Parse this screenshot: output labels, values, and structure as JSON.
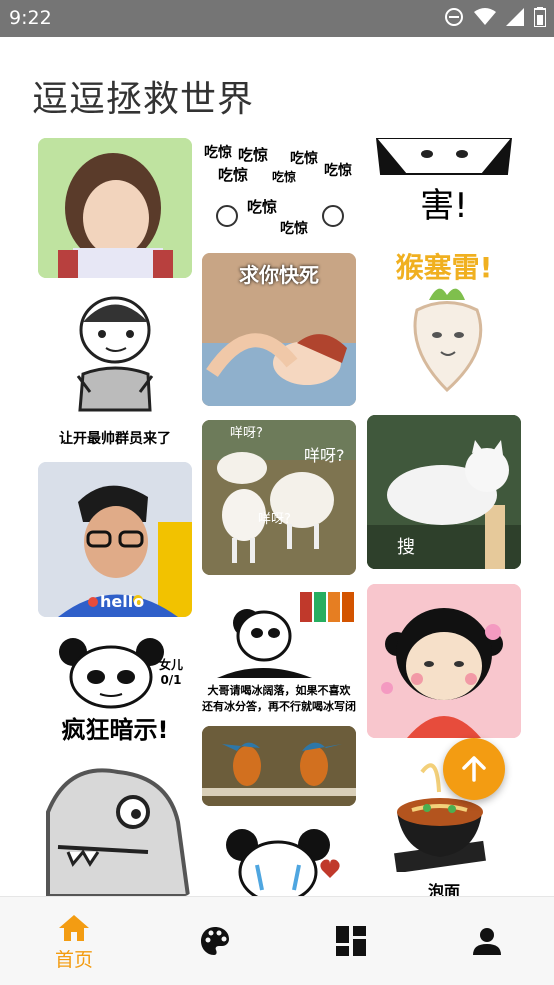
{
  "status": {
    "time": "9:22"
  },
  "app": {
    "title": "逗逗拯救世界"
  },
  "grid": {
    "c2_amazed_text": "吃惊",
    "c2_please_die": "求你快死",
    "c1_group_caption": "让开最帅群员来了",
    "c1_hello": "hello",
    "c2_sheep1": "咩呀?",
    "c2_sheep2": "咩呀?",
    "c2_sheep3": "咩呀?",
    "c3_top_caption": "害!",
    "c3_radish": "猴塞雷!",
    "c3_cat": "搜",
    "c1_panda_caption": "疯狂暗示!",
    "c1_panda_badge": "女儿 0/1",
    "c2_icewater_line1": "大哥请喝冰阔落，如果不喜欢",
    "c2_icewater_line2": "还有冰分答，再不行就喝冰写闭",
    "c3_noodle": "泡面"
  },
  "colors": {
    "accent": "#f39c12",
    "statusbar": "#757575"
  },
  "nav": {
    "items": [
      {
        "label": "首页",
        "icon": "home-icon",
        "active": true
      },
      {
        "icon": "palette-icon"
      },
      {
        "icon": "dashboard-icon"
      },
      {
        "icon": "person-icon"
      }
    ]
  }
}
